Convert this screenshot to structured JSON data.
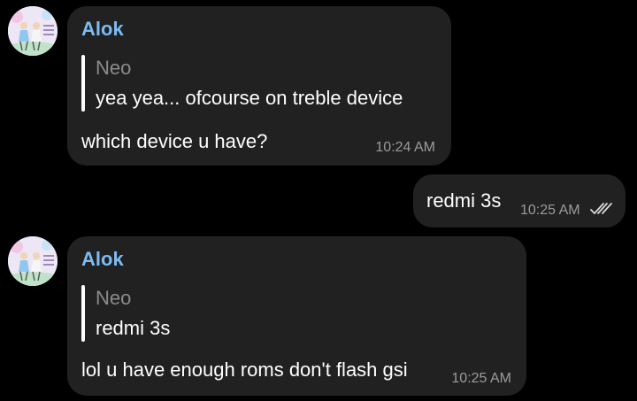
{
  "colors": {
    "background": "#000000",
    "bubble": "#212121",
    "sender_name": "#7dbbf2",
    "quote_name": "#8b8b8b",
    "timestamp": "#9b9b9b"
  },
  "messages": [
    {
      "direction": "incoming",
      "avatar_icon": "profile-picture-icon",
      "sender": "Alok",
      "reply_to": {
        "name": "Neo",
        "text": "yea yea... ofcourse on treble device"
      },
      "text": "which device u have?",
      "time": "10:24 AM"
    },
    {
      "direction": "outgoing",
      "text": "redmi 3s",
      "time": "10:25 AM",
      "status_icon": "double-check-icon"
    },
    {
      "direction": "incoming",
      "avatar_icon": "profile-picture-icon",
      "sender": "Alok",
      "reply_to": {
        "name": "Neo",
        "text": "redmi 3s"
      },
      "text": "lol u have enough roms don't flash gsi",
      "time": "10:25 AM"
    }
  ]
}
